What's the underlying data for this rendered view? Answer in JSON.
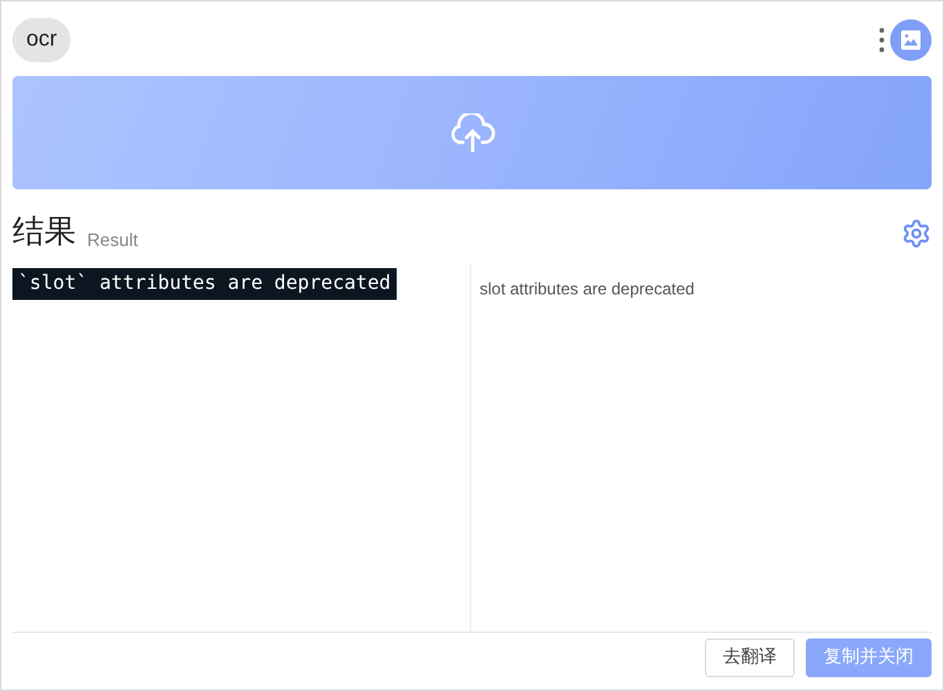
{
  "header": {
    "mode_chip": "ocr"
  },
  "result": {
    "title": "结果",
    "subtitle": "Result",
    "source_capture": "`slot` attributes are deprecated",
    "recognized_text": "slot attributes are deprecated"
  },
  "buttons": [
    {
      "label": "去翻译",
      "kind": "secondary"
    },
    {
      "label": "复制并关闭",
      "kind": "primary"
    }
  ]
}
